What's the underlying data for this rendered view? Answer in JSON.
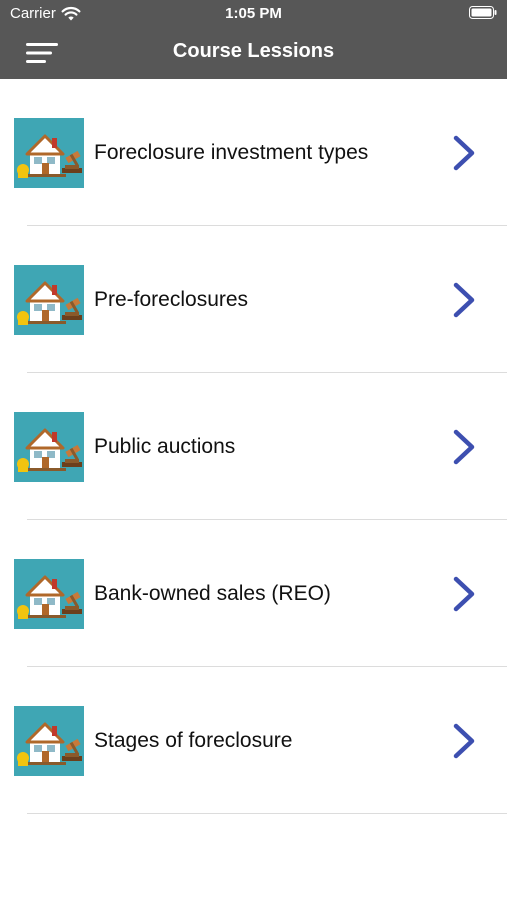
{
  "status_bar": {
    "carrier": "Carrier",
    "time": "1:05 PM"
  },
  "nav": {
    "title": "Course Lessions",
    "menu_icon": "hamburger-menu-icon"
  },
  "lessons": [
    {
      "title": "Foreclosure investment types",
      "icon": "house-auction-icon"
    },
    {
      "title": "Pre-foreclosures",
      "icon": "house-auction-icon"
    },
    {
      "title": "Public auctions",
      "icon": "house-auction-icon"
    },
    {
      "title": "Bank-owned sales (REO)",
      "icon": "house-auction-icon"
    },
    {
      "title": "Stages of foreclosure",
      "icon": "house-auction-icon"
    }
  ],
  "colors": {
    "header_bg": "#575757",
    "thumb_bg": "#3fa6b4",
    "chevron": "#3d4fb0",
    "divider": "#dcdcdc"
  }
}
